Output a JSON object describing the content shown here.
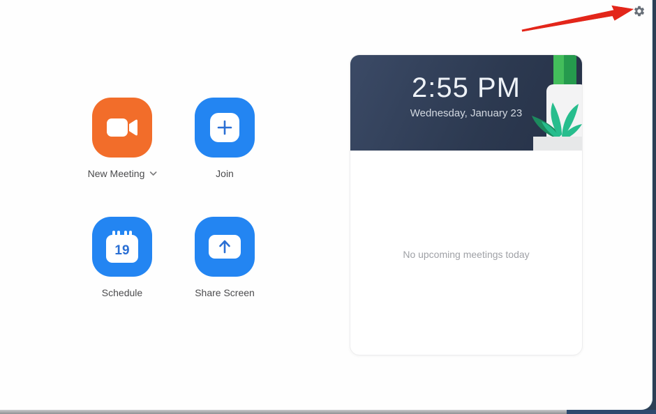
{
  "window": {
    "settings_icon": "gear",
    "edge_colors": {
      "desktop_navy": "#2e4a6e",
      "bottom_gray": "#9a9b9e"
    }
  },
  "annotation_arrow": {
    "shape": "red-arrow",
    "color": "#e3261a",
    "points_to": "settings-gear-icon"
  },
  "actions": {
    "new_meeting": {
      "label": "New Meeting",
      "tile_color": "#f26d2a",
      "icon": "video-camera-icon",
      "has_dropdown": true
    },
    "join": {
      "label": "Join",
      "tile_color": "#2385f2",
      "icon": "plus-icon"
    },
    "schedule": {
      "label": "Schedule",
      "tile_color": "#2385f2",
      "icon": "calendar-icon",
      "calendar_day": "19"
    },
    "share_screen": {
      "label": "Share Screen",
      "tile_color": "#2385f2",
      "icon": "screen-share-icon"
    }
  },
  "meetings_panel": {
    "time": "2:55 PM",
    "date": "Wednesday, January 23",
    "empty_message": "No upcoming meetings today",
    "header_color": "#2c3950",
    "plant_colors": {
      "stalk_light": "#43bd5b",
      "stalk_dark": "#259a4d",
      "leaf_teal": "#27bd8d",
      "leaf_dark": "#1c8a5e",
      "pot": "#f3f3f4",
      "pot_base": "#e7e8e9"
    }
  }
}
